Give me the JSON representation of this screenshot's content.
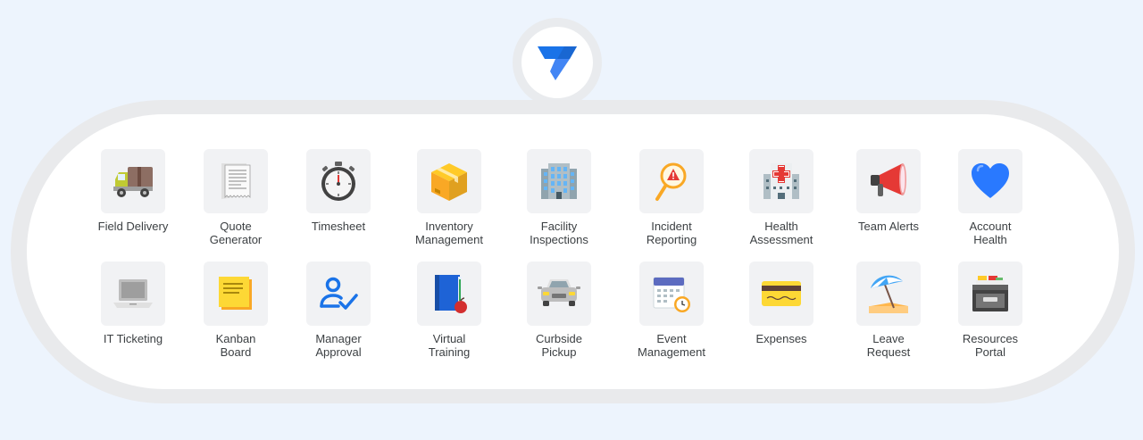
{
  "apps": [
    {
      "id": "field-delivery",
      "label": "Field Delivery",
      "icon": "delivery-truck-icon"
    },
    {
      "id": "quote-generator",
      "label": "Quote\nGenerator",
      "icon": "receipt-icon"
    },
    {
      "id": "timesheet",
      "label": "Timesheet",
      "icon": "stopwatch-icon"
    },
    {
      "id": "inventory-management",
      "label": "Inventory\nManagement",
      "icon": "package-icon"
    },
    {
      "id": "facility-inspections",
      "label": "Facility\nInspections",
      "icon": "office-building-icon"
    },
    {
      "id": "incident-reporting",
      "label": "Incident\nReporting",
      "icon": "magnifier-warning-icon"
    },
    {
      "id": "health-assessment",
      "label": "Health\nAssessment",
      "icon": "hospital-icon"
    },
    {
      "id": "team-alerts",
      "label": "Team Alerts",
      "icon": "megaphone-icon"
    },
    {
      "id": "account-health",
      "label": "Account\nHealth",
      "icon": "blue-heart-icon"
    },
    {
      "id": "it-ticketing",
      "label": "IT Ticketing",
      "icon": "laptop-icon"
    },
    {
      "id": "kanban-board",
      "label": "Kanban\nBoard",
      "icon": "sticky-note-icon"
    },
    {
      "id": "manager-approval",
      "label": "Manager\nApproval",
      "icon": "user-check-icon"
    },
    {
      "id": "virtual-training",
      "label": "Virtual\nTraining",
      "icon": "notebook-apple-icon"
    },
    {
      "id": "curbside-pickup",
      "label": "Curbside\nPickup",
      "icon": "car-icon"
    },
    {
      "id": "event-management",
      "label": "Event\nManagement",
      "icon": "calendar-clock-icon"
    },
    {
      "id": "expenses",
      "label": "Expenses",
      "icon": "credit-card-icon"
    },
    {
      "id": "leave-request",
      "label": "Leave\nRequest",
      "icon": "beach-umbrella-icon"
    },
    {
      "id": "resources-portal",
      "label": "Resources\nPortal",
      "icon": "card-file-box-icon"
    }
  ],
  "brand": {
    "logo": "appsheet-logo-icon",
    "accent": "#4285f4"
  }
}
